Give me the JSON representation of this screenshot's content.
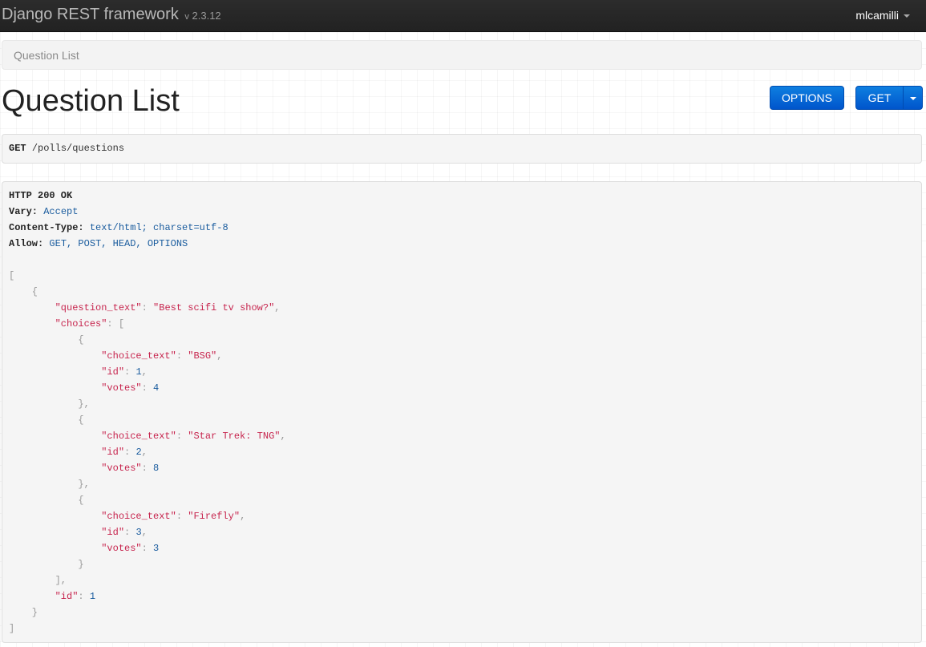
{
  "navbar": {
    "brand": "Django REST framework",
    "version_prefix": "v",
    "version": "2.3.12",
    "user": "mlcamilli"
  },
  "breadcrumb": {
    "item": "Question List"
  },
  "page": {
    "title": "Question List"
  },
  "buttons": {
    "options": "OPTIONS",
    "get": "GET"
  },
  "request": {
    "method": "GET",
    "path": "/polls/questions"
  },
  "response": {
    "status": "HTTP 200 OK",
    "headers": [
      {
        "name": "Vary:",
        "value": "Accept"
      },
      {
        "name": "Content-Type:",
        "value": "text/html; charset=utf-8"
      },
      {
        "name": "Allow:",
        "value": "GET, POST, HEAD, OPTIONS"
      }
    ],
    "body": {
      "question_key": "\"question_text\"",
      "question_value": "\"Best scifi tv show?\"",
      "choices_key": "\"choices\"",
      "choice_text_key": "\"choice_text\"",
      "id_key": "\"id\"",
      "votes_key": "\"votes\"",
      "choices": [
        {
          "choice_text": "\"BSG\"",
          "id": "1",
          "votes": "4"
        },
        {
          "choice_text": "\"Star Trek: TNG\"",
          "id": "2",
          "votes": "8"
        },
        {
          "choice_text": "\"Firefly\"",
          "id": "3",
          "votes": "3"
        }
      ],
      "question_id": "1"
    }
  },
  "colors": {
    "navbar_bg": "#222222",
    "button_blue": "#0066cc",
    "json_key": "#c7254e",
    "json_number": "#1a5c9e"
  }
}
